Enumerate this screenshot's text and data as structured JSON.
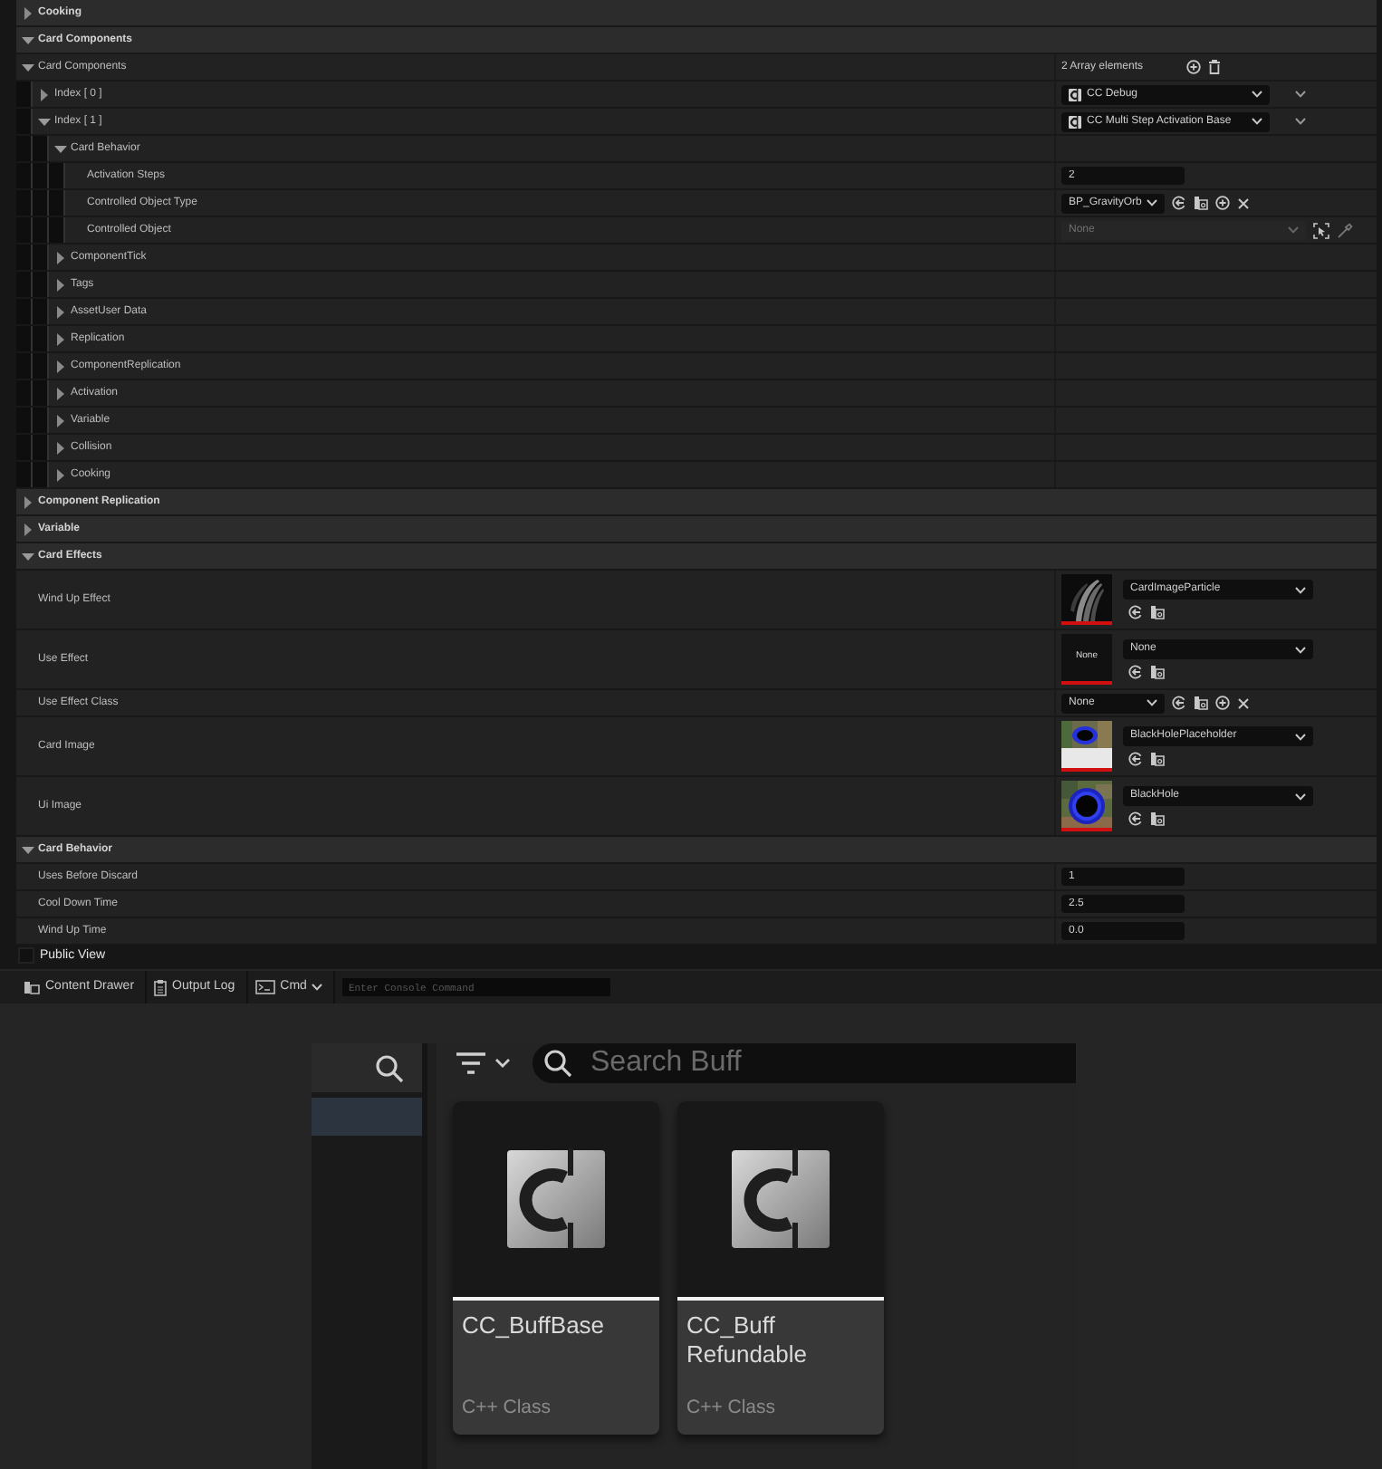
{
  "details": {
    "rows": [
      {
        "label": "Cooking",
        "expanded": false
      },
      {
        "label": "Card Components",
        "expanded": true,
        "children": [
          {
            "label": "Card Components",
            "expanded": true,
            "value": {
              "kind": "array",
              "text": "2 Array elements"
            },
            "children": [
              {
                "label": "Index [ 0 ]",
                "expanded": false,
                "value": {
                  "kind": "class",
                  "text": "CC Debug"
                }
              },
              {
                "label": "Index [ 1 ]",
                "expanded": true,
                "value": {
                  "kind": "class",
                  "text": "CC Multi Step Activation Base"
                },
                "children": [
                  {
                    "label": "Card Behavior",
                    "expanded": true,
                    "children": [
                      {
                        "label": "Activation Steps",
                        "value": {
                          "kind": "number",
                          "text": "2"
                        }
                      },
                      {
                        "label": "Controlled Object Type",
                        "value": {
                          "kind": "class_picker",
                          "text": "BP_GravityOrb"
                        }
                      },
                      {
                        "label": "Controlled Object",
                        "value": {
                          "kind": "object",
                          "text": "None",
                          "disabled": true
                        }
                      }
                    ]
                  },
                  {
                    "label": "ComponentTick",
                    "expanded": false
                  },
                  {
                    "label": "Tags",
                    "expanded": false
                  },
                  {
                    "label": "AssetUser Data",
                    "expanded": false
                  },
                  {
                    "label": "Replication",
                    "expanded": false
                  },
                  {
                    "label": "ComponentReplication",
                    "expanded": false
                  },
                  {
                    "label": "Activation",
                    "expanded": false
                  },
                  {
                    "label": "Variable",
                    "expanded": false
                  },
                  {
                    "label": "Collision",
                    "expanded": false
                  },
                  {
                    "label": "Cooking",
                    "expanded": false
                  }
                ]
              }
            ]
          }
        ]
      },
      {
        "label": "Component Replication",
        "expanded": false
      },
      {
        "label": "Variable",
        "expanded": false
      },
      {
        "label": "Card Effects",
        "expanded": true,
        "children": [
          {
            "label": "Wind Up Effect",
            "value": {
              "kind": "asset",
              "text": "CardImageParticle"
            }
          },
          {
            "label": "Use Effect",
            "value": {
              "kind": "asset",
              "text": "None",
              "thumbnail": {
                "kind": "text",
                "text": "None"
              }
            }
          },
          {
            "label": "Use Effect Class",
            "value": {
              "kind": "class_picker",
              "text": "None"
            }
          },
          {
            "label": "Card Image",
            "value": {
              "kind": "asset",
              "text": "BlackHolePlaceholder"
            }
          },
          {
            "label": "Ui Image",
            "value": {
              "kind": "asset",
              "text": "BlackHole"
            }
          }
        ]
      },
      {
        "label": "Card Behavior",
        "expanded": true,
        "children": [
          {
            "label": "Uses Before Discard",
            "value": {
              "kind": "number",
              "text": "1"
            }
          },
          {
            "label": "Cool Down Time",
            "value": {
              "kind": "number",
              "text": "2.5"
            }
          },
          {
            "label": "Wind Up Time",
            "value": {
              "kind": "number",
              "text": "0.0"
            }
          }
        ]
      }
    ]
  },
  "public_view": {
    "label": "Public View",
    "checked": false
  },
  "status_bar": {
    "items": [
      {
        "kind": "drawer",
        "label": "Content Drawer"
      },
      {
        "kind": "log",
        "label": "Output Log"
      },
      {
        "kind": "cmd",
        "label": "Cmd"
      }
    ],
    "console": {
      "placeholder": "Enter Console Command"
    }
  },
  "content_browser": {
    "search": {
      "placeholder": "Search Buff"
    },
    "assets": [
      {
        "name": "CC_BuffBase",
        "type": "C++ Class"
      },
      {
        "name": "CC_Buff Refundable",
        "type": "C++ Class"
      }
    ]
  }
}
